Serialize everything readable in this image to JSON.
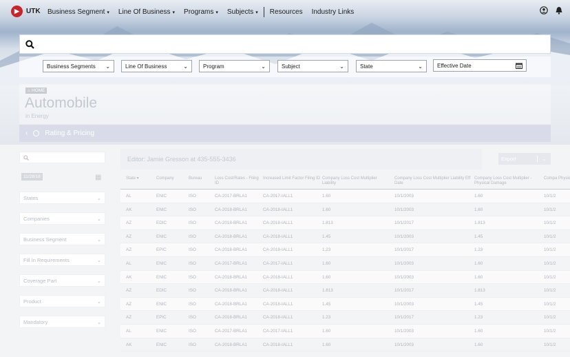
{
  "nav": {
    "logo_text": "UTK",
    "logo_glyph": "▶",
    "items": [
      {
        "label": "Business Segment",
        "caret": "▾"
      },
      {
        "label": "Line Of Business",
        "caret": "▾"
      },
      {
        "label": "Programs",
        "caret": "▾"
      },
      {
        "label": "Subjects",
        "caret": "▾"
      }
    ],
    "links": [
      "Resources",
      "Industry Links"
    ],
    "icons": [
      "account-icon",
      "bell-icon"
    ]
  },
  "search": {
    "value": ""
  },
  "filters": [
    {
      "label": "Business Segments"
    },
    {
      "label": "Line Of Business"
    },
    {
      "label": "Program"
    },
    {
      "label": "Subject"
    },
    {
      "label": "State"
    }
  ],
  "effective_date": {
    "label": "Effective Date"
  },
  "breadcrumb": {
    "home": "HOME"
  },
  "page": {
    "title": "Automobile",
    "subtitle": "in Energy"
  },
  "section": {
    "title": "Rating & Pricing"
  },
  "sidebar": {
    "date": "11/28/18",
    "items": [
      "States",
      "Companies",
      "Business Segment",
      "Fill In Requirements",
      "Coverage Part",
      "Product",
      "Mandatory"
    ]
  },
  "editor": {
    "text": "Editor: Jamie Gresson at 435-555-3436"
  },
  "export": {
    "label": "Export"
  },
  "table": {
    "columns": [
      "State ▾",
      "Company",
      "Bureau",
      "Loss Cost/Rates - Filing ID",
      "Increased Limit Factor Filing ID",
      "Company Loss Cost Multiplier Liability",
      "Company Loss Cost Multiplier Liability Eff Date",
      "Company Loss Cost Multiplier - Physical Damage",
      "Compa Physic"
    ],
    "rows": [
      [
        "AL",
        "ENIC",
        "ISO",
        "CA-2017-BRLA1",
        "CA-2017-IALL1",
        "1.60",
        "10/1/2003",
        "1.60",
        "10/1/2"
      ],
      [
        "AK",
        "ENIC",
        "ISO",
        "CA-2018-BRLA1",
        "CA-2018-IALL1",
        "1.60",
        "10/1/2003",
        "1.60",
        "10/1/2"
      ],
      [
        "AZ",
        "EDIC",
        "ISO",
        "CA-2018-BRLA1",
        "CA-2018-IALL1",
        "1.813",
        "10/1/2017",
        "1.813",
        "10/1/2"
      ],
      [
        "AZ",
        "ENIC",
        "ISO",
        "CA-2018-BRLA1",
        "CA-2018-IALL1",
        "1.45",
        "10/1/2003",
        "1.45",
        "10/1/2"
      ],
      [
        "AZ",
        "EPIC",
        "ISO",
        "CA-2018-BRLA1",
        "CA-2018-IALL1",
        "1.23",
        "10/1/2017",
        "1.23",
        "10/1/2"
      ],
      [
        "AL",
        "ENIC",
        "ISO",
        "CA-2017-BRLA1",
        "CA-2017-IALL1",
        "1.60",
        "10/1/2003",
        "1.60",
        "10/1/2"
      ],
      [
        "AK",
        "ENIC",
        "ISO",
        "CA-2018-BRLA1",
        "CA-2018-IALL1",
        "1.60",
        "10/1/2003",
        "1.60",
        "10/1/2"
      ],
      [
        "AZ",
        "EDIC",
        "ISO",
        "CA-2018-BRLA1",
        "CA-2018-IALL1",
        "1.813",
        "10/1/2017",
        "1.813",
        "10/1/2"
      ],
      [
        "AZ",
        "ENIC",
        "ISO",
        "CA-2018-BRLA1",
        "CA-2018-IALL1",
        "1.45",
        "10/1/2003",
        "1.45",
        "10/1/2"
      ],
      [
        "AZ",
        "EPIC",
        "ISO",
        "CA-2018-BRLA1",
        "CA-2018-IALL1",
        "1.23",
        "10/1/2017",
        "1.23",
        "10/1/2"
      ],
      [
        "AL",
        "ENIC",
        "ISO",
        "CA-2017-BRLA1",
        "CA-2017-IALL1",
        "1.60",
        "10/1/2003",
        "1.60",
        "10/1/2"
      ],
      [
        "AK",
        "ENIC",
        "ISO",
        "CA-2018-BRLA1",
        "CA-2018-IALL1",
        "1.60",
        "10/1/2003",
        "1.60",
        "10/1/2"
      ]
    ]
  }
}
